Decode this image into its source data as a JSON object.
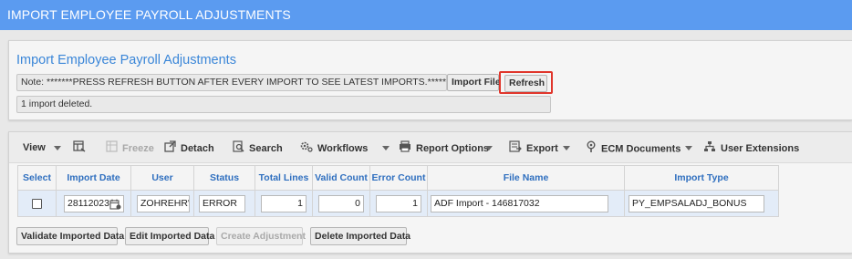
{
  "window": {
    "title": "IMPORT EMPLOYEE PAYROLL ADJUSTMENTS"
  },
  "header_panel": {
    "title": "Import Employee Payroll Adjustments",
    "note": "Note: *******PRESS REFRESH BUTTON AFTER EVERY IMPORT TO SEE LATEST IMPORTS.*******",
    "status_message": "1 import deleted.",
    "import_file_label": "Import File",
    "refresh_label": "Refresh",
    "highlight_color": "#e0362c"
  },
  "toolbar": {
    "view_label": "View",
    "freeze_label": "Freeze",
    "detach_label": "Detach",
    "search_label": "Search",
    "workflows_label": "Workflows",
    "report_options_label": "Report Options",
    "export_label": "Export",
    "ecm_documents_label": "ECM Documents",
    "user_extensions_label": "User Extensions"
  },
  "grid": {
    "columns": [
      "Select",
      "Import Date",
      "User",
      "Status",
      "Total Lines",
      "Valid Count",
      "Error Count",
      "File Name",
      "Import Type"
    ],
    "rows": [
      {
        "selected": false,
        "import_date": "28112023",
        "user": "ZOHREHR'",
        "status": "ERROR",
        "total_lines": "1",
        "valid_count": "0",
        "error_count": "1",
        "file_name": "ADF Import - 146817032",
        "import_type": "PY_EMPSALADJ_BONUS"
      }
    ]
  },
  "actions": {
    "validate_label": "Validate Imported Data",
    "edit_label": "Edit Imported Data",
    "create_label": "Create Adjustment",
    "delete_label": "Delete Imported Data"
  },
  "colors": {
    "title_bar": "#5b9bf0",
    "panel_title": "#3a86d8",
    "header_text": "#2f6fbf",
    "row_bg": "#e3ecf8"
  }
}
